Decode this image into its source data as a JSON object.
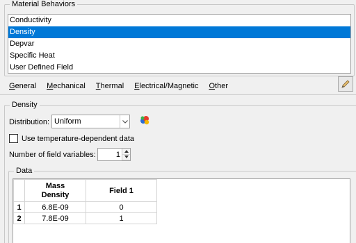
{
  "material_behaviors": {
    "legend": "Material Behaviors",
    "items": [
      {
        "label": "Conductivity",
        "selected": false
      },
      {
        "label": "Density",
        "selected": true
      },
      {
        "label": "Depvar",
        "selected": false
      },
      {
        "label": "Specific Heat",
        "selected": false
      },
      {
        "label": "User Defined Field",
        "selected": false
      }
    ]
  },
  "menu": {
    "items": [
      {
        "mnemonic": "G",
        "rest": "eneral"
      },
      {
        "mnemonic": "M",
        "rest": "echanical"
      },
      {
        "mnemonic": "T",
        "rest": "hermal"
      },
      {
        "mnemonic": "E",
        "rest": "lectrical/Magnetic"
      },
      {
        "mnemonic": "O",
        "rest": "ther"
      }
    ],
    "tool_icon": "edit-pencil-icon"
  },
  "density": {
    "legend": "Density",
    "distribution_label": "Distribution:",
    "distribution_value": "Uniform",
    "distribution_icon": "colorful-molecule-icon",
    "temp_dependent_label": "Use temperature-dependent data",
    "temp_dependent_checked": false,
    "field_vars_label": "Number of field variables:",
    "field_vars_value": "1"
  },
  "data": {
    "legend": "Data",
    "columns": [
      "Mass Density",
      "Field 1"
    ],
    "rows": [
      {
        "index": "1",
        "mass_density": "6.8E-09",
        "field1": "0"
      },
      {
        "index": "2",
        "mass_density": "7.8E-09",
        "field1": "1"
      }
    ]
  }
}
